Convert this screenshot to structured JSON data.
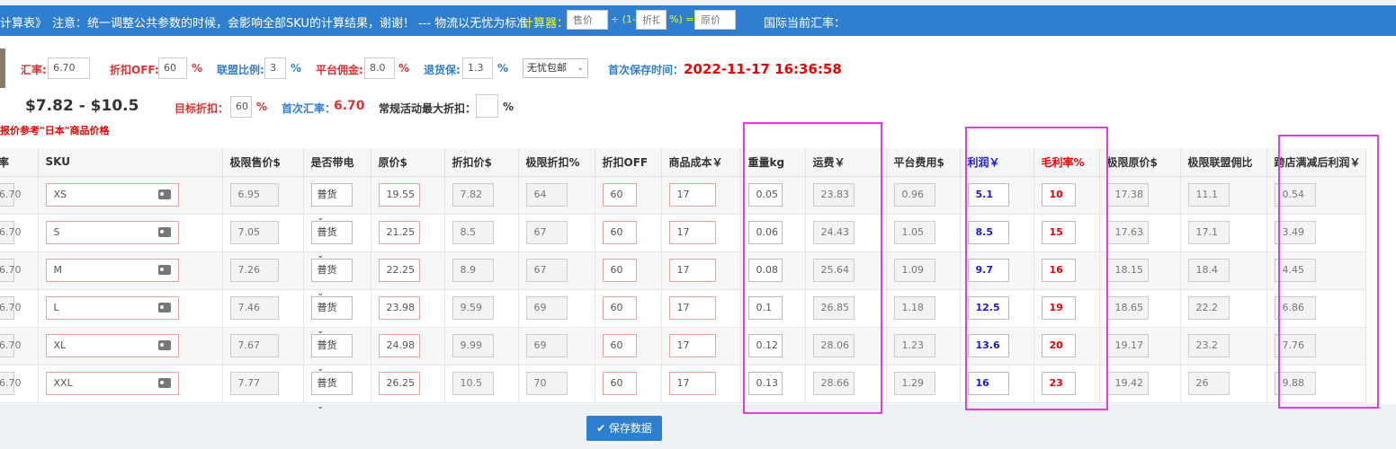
{
  "header": {
    "title_fragment": "计算表》",
    "notice": "注意：统一调整公共参数的时候，会影响全部SKU的计算结果，谢谢！ --- 物流以无忧为标准",
    "calc_label": "计算器：",
    "calc_price_placeholder": "售价",
    "calc_op1": "÷ (1-",
    "calc_discount_placeholder": "折扣",
    "calc_op2": "%) =",
    "calc_result_placeholder": "原价",
    "fx_label": "国际当前汇率："
  },
  "params": {
    "rate_label": "汇率:",
    "rate_value": "6.70",
    "discount_off_label": "折扣OFF:",
    "discount_off_value": "60",
    "percent": "%",
    "affiliate_label": "联盟比例:",
    "affiliate_value": "3",
    "commission_label": "平台佣金:",
    "commission_value": "8.0",
    "return_label": "退货保:",
    "return_value": "1.3",
    "shipping_select": "无忧包邮",
    "first_save_label": "首次保存时间：",
    "first_save_time": "2022-11-17 16:36:58",
    "price_range": "$7.82 - $10.5",
    "target_discount_label": "目标折扣：",
    "target_discount_value": "60",
    "first_rate_label": "首次汇率：",
    "first_rate_value": "6.70",
    "max_discount_label": "常规活动最大折扣：",
    "max_discount_value": "",
    "ref_note": "报价参考\"日本\"商品价格"
  },
  "table": {
    "headers": [
      "率",
      "SKU",
      "极限售价$",
      "是否带电",
      "原价$",
      "折扣价$",
      "极限折扣%",
      "折扣OFF",
      "商品成本￥",
      "重量kg",
      "运费￥",
      "平台费用$",
      "利润￥",
      "毛利率%",
      "极限原价$",
      "极限联盟佣比",
      "跨店满减后利润￥"
    ],
    "rows": [
      {
        "rate": "6.70",
        "sku": "XS",
        "limit_price": "6.95",
        "electric": "普货",
        "orig": "19.55",
        "disc_price": "7.82",
        "limit_disc": "64",
        "off": "60",
        "cost": "17",
        "weight": "0.05",
        "freight": "23.83",
        "fee": "0.96",
        "profit": "5.1",
        "margin": "10",
        "limit_orig": "17.38",
        "aff_ratio": "11.1",
        "cross_profit": "0.54"
      },
      {
        "rate": "6.70",
        "sku": "S",
        "limit_price": "7.05",
        "electric": "普货",
        "orig": "21.25",
        "disc_price": "8.5",
        "limit_disc": "67",
        "off": "60",
        "cost": "17",
        "weight": "0.06",
        "freight": "24.43",
        "fee": "1.05",
        "profit": "8.5",
        "margin": "15",
        "limit_orig": "17.63",
        "aff_ratio": "17.1",
        "cross_profit": "3.49"
      },
      {
        "rate": "6.70",
        "sku": "M",
        "limit_price": "7.26",
        "electric": "普货",
        "orig": "22.25",
        "disc_price": "8.9",
        "limit_disc": "67",
        "off": "60",
        "cost": "17",
        "weight": "0.08",
        "freight": "25.64",
        "fee": "1.09",
        "profit": "9.7",
        "margin": "16",
        "limit_orig": "18.15",
        "aff_ratio": "18.4",
        "cross_profit": "4.45"
      },
      {
        "rate": "6.70",
        "sku": "L",
        "limit_price": "7.46",
        "electric": "普货",
        "orig": "23.98",
        "disc_price": "9.59",
        "limit_disc": "69",
        "off": "60",
        "cost": "17",
        "weight": "0.1",
        "freight": "26.85",
        "fee": "1.18",
        "profit": "12.5",
        "margin": "19",
        "limit_orig": "18.65",
        "aff_ratio": "22.2",
        "cross_profit": "6.86"
      },
      {
        "rate": "6.70",
        "sku": "XL",
        "limit_price": "7.67",
        "electric": "普货",
        "orig": "24.98",
        "disc_price": "9.99",
        "limit_disc": "69",
        "off": "60",
        "cost": "17",
        "weight": "0.12",
        "freight": "28.06",
        "fee": "1.23",
        "profit": "13.6",
        "margin": "20",
        "limit_orig": "19.17",
        "aff_ratio": "23.2",
        "cross_profit": "7.76"
      },
      {
        "rate": "6.70",
        "sku": "XXL",
        "limit_price": "7.77",
        "electric": "普货",
        "orig": "26.25",
        "disc_price": "10.5",
        "limit_disc": "70",
        "off": "60",
        "cost": "17",
        "weight": "0.13",
        "freight": "28.66",
        "fee": "1.29",
        "profit": "16",
        "margin": "23",
        "limit_orig": "19.42",
        "aff_ratio": "26",
        "cross_profit": "9.88"
      }
    ]
  },
  "save_button": "✔ 保存数据",
  "colors": {
    "header_bg": "#2f7fd0",
    "highlight": "#e53be5",
    "profit": "#1a1adb",
    "margin": "#e00000"
  }
}
